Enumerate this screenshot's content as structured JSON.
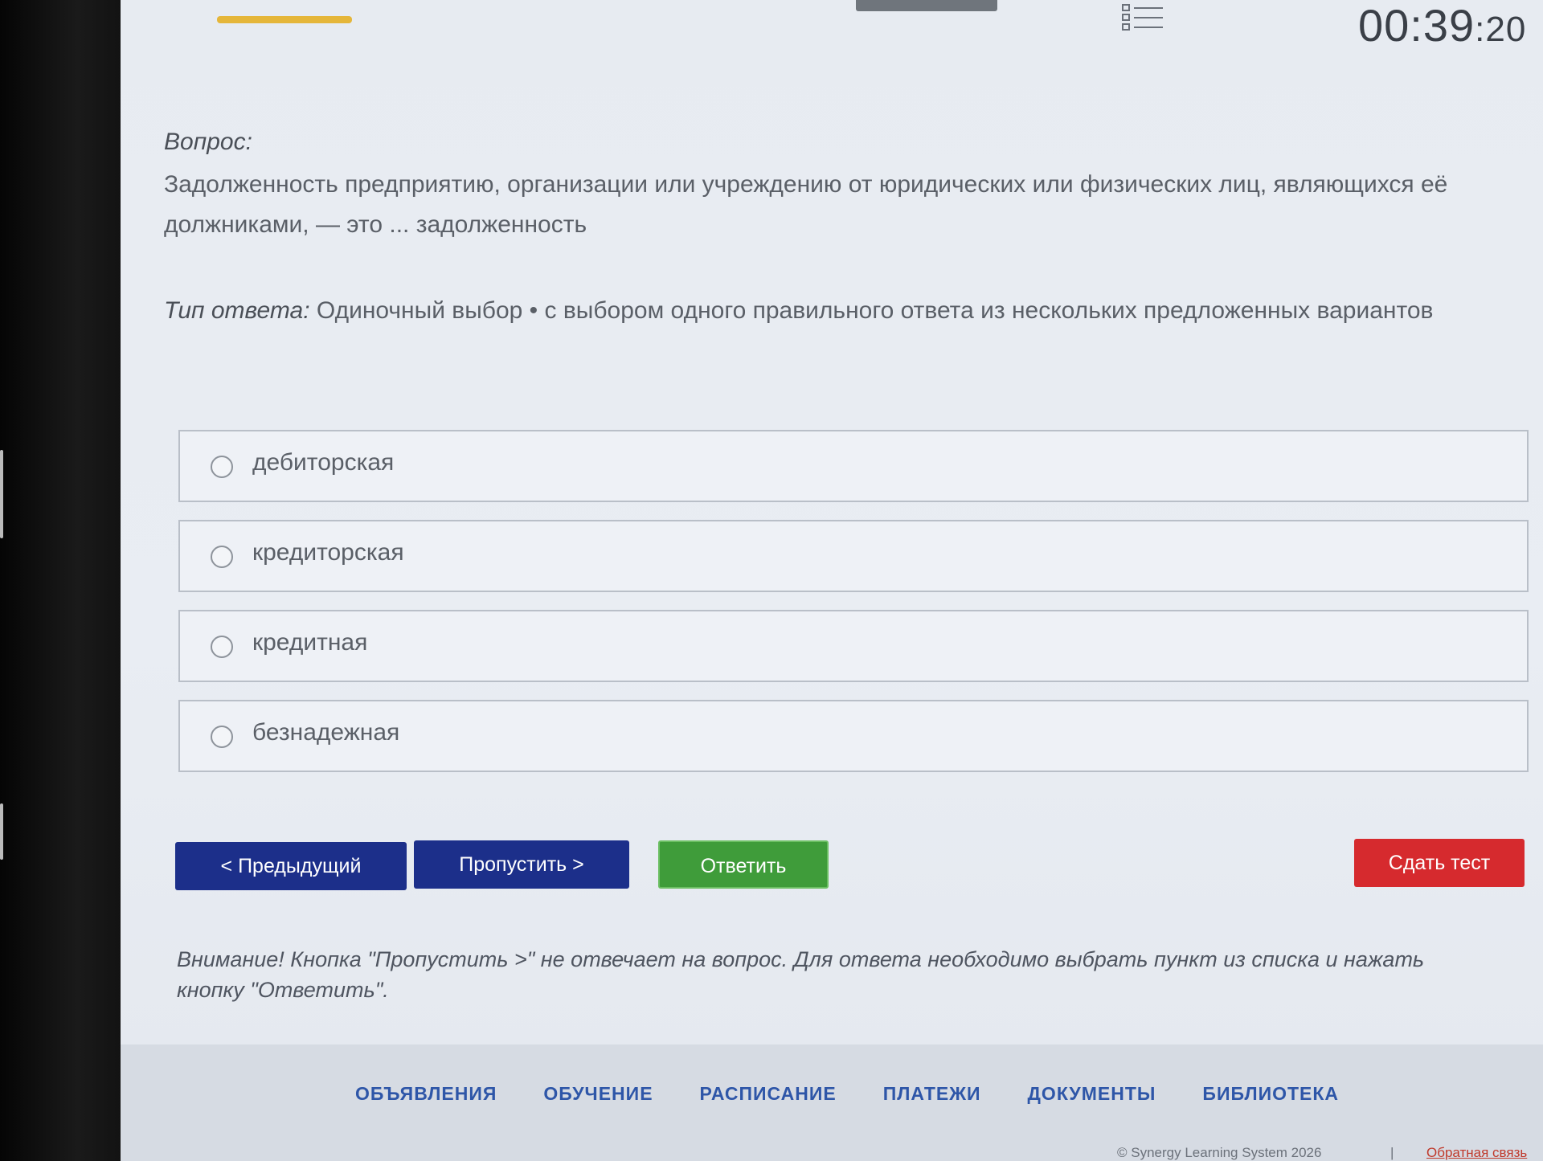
{
  "timer": {
    "main": "00:39",
    "seconds": ":20"
  },
  "question": {
    "label": "Вопрос:",
    "text": "Задолженность предприятию, организации или учреждению от юридических или физических лиц, являющихся её должниками, — это ... задолженность"
  },
  "answer_type": {
    "label": "Тип ответа:",
    "value": " Одиночный выбор • с выбором одного правильного ответа из нескольких предложенных вариантов"
  },
  "options": [
    {
      "label": "дебиторская"
    },
    {
      "label": "кредиторская"
    },
    {
      "label": "кредитная"
    },
    {
      "label": "безнадежная"
    }
  ],
  "buttons": {
    "prev": "< Предыдущий",
    "skip": "Пропустить >",
    "answer": "Ответить",
    "submit": "Сдать тест"
  },
  "notice": "Внимание! Кнопка \"Пропустить >\" не отвечает на вопрос. Для ответа необходимо выбрать пункт из списка и нажать кнопку \"Ответить\".",
  "footer": {
    "nav": [
      "ОБЪЯВЛЕНИЯ",
      "ОБУЧЕНИЕ",
      "РАСПИСАНИЕ",
      "ПЛАТЕЖИ",
      "ДОКУМЕНТЫ",
      "БИБЛИОТЕКА"
    ],
    "copyright": "© Synergy Learning System 2026",
    "separator": "|",
    "feedback": "Обратная связь"
  },
  "colors": {
    "primary": "#1c2f8a",
    "answer": "#3f9c3a",
    "submit": "#d62a2e",
    "progress": "#e5b63a",
    "footer_link": "#2e56a8"
  }
}
